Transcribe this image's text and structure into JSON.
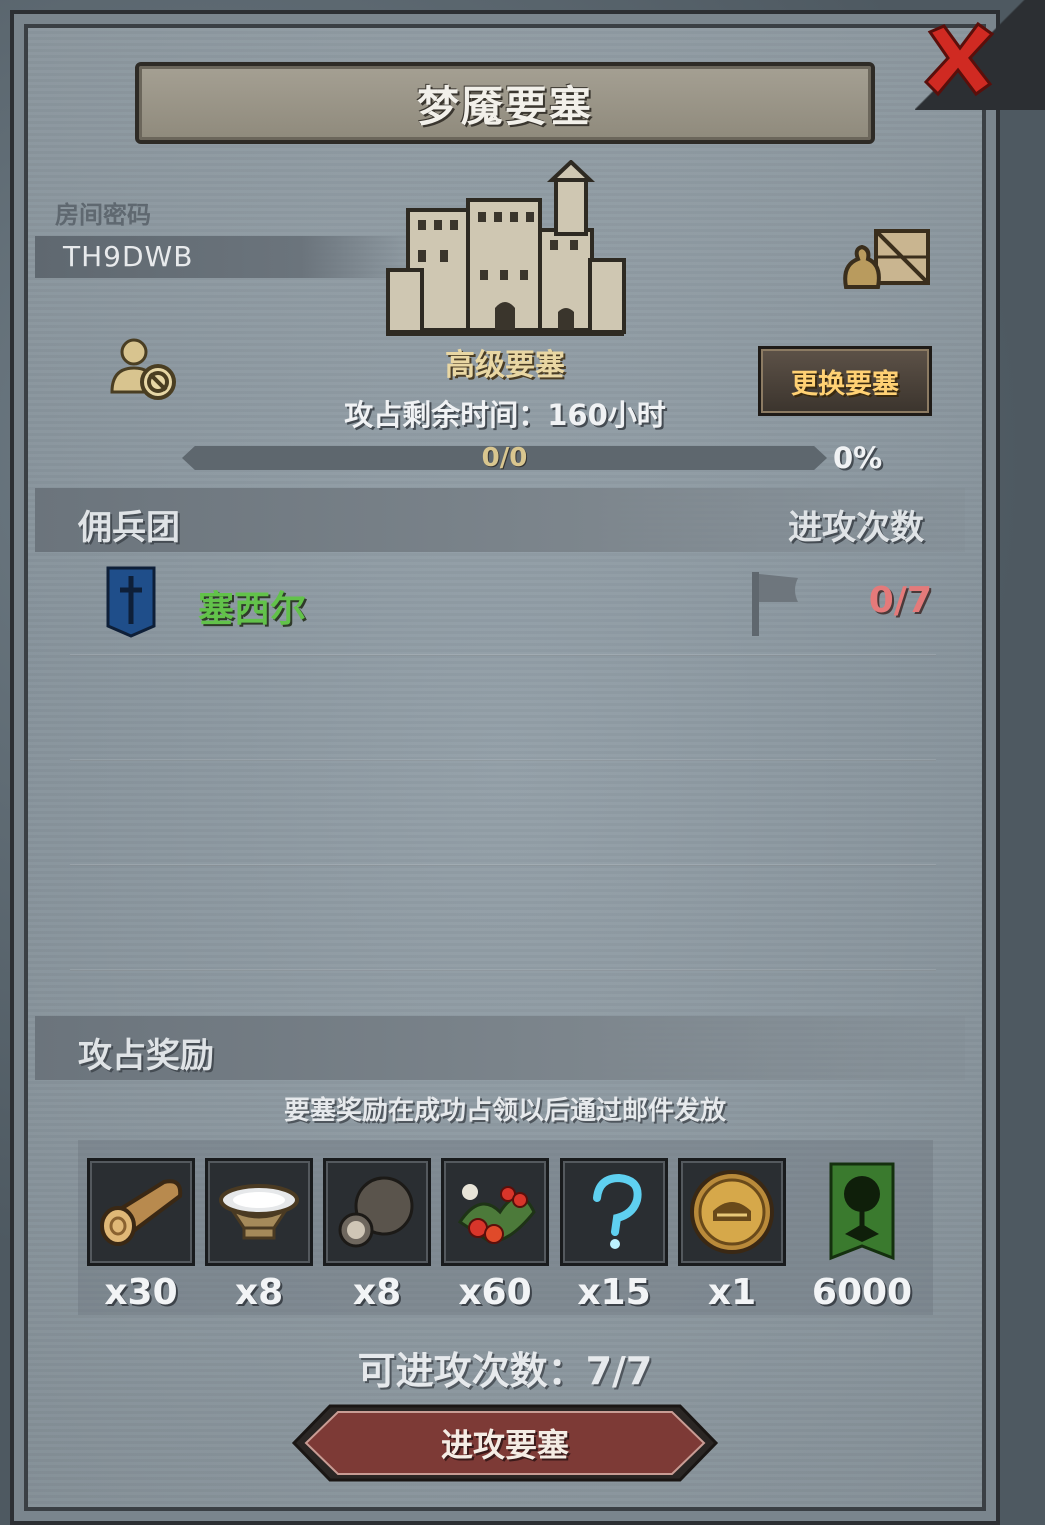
{
  "dialog": {
    "title": "梦魇要塞",
    "room_label": "房间密码",
    "room_code": "TH9DWB",
    "fortress_name": "高级要塞",
    "change_fortress_label": "更换要塞",
    "time_remaining_text": "攻占剩余时间：160小时",
    "progress": {
      "text": "0/0",
      "percent_text": "0%",
      "fraction": 0
    }
  },
  "mercenary_section": {
    "title": "佣兵团",
    "attack_count_header": "进攻次数",
    "rows": [
      {
        "name": "塞西尔",
        "count": "0/7"
      }
    ]
  },
  "rewards_section": {
    "title": "攻占奖励",
    "note": "要塞奖励在成功占领以后通过邮件发放",
    "items": [
      {
        "icon": "log-icon",
        "qty": "x30"
      },
      {
        "icon": "silver-bowl-icon",
        "qty": "x8"
      },
      {
        "icon": "truffle-icon",
        "qty": "x8"
      },
      {
        "icon": "berries-icon",
        "qty": "x60"
      },
      {
        "icon": "blue-question-icon",
        "qty": "x15"
      },
      {
        "icon": "golden-helmet-icon",
        "qty": "x1"
      },
      {
        "icon": "tree-banner-icon",
        "qty": "6000"
      }
    ]
  },
  "attempts_text": "可进攻次数：7/7",
  "attack_button_label": "进攻要塞",
  "colors": {
    "merc_name": "#62c24a",
    "merc_count": "#e47a7a",
    "fortress_name": "#e9d7a3",
    "change_button_text": "#ffd174"
  }
}
